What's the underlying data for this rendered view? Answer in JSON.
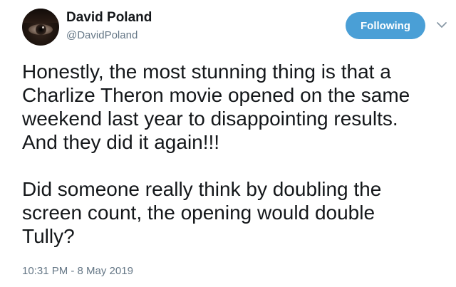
{
  "author": {
    "display_name": "David Poland",
    "handle": "@DavidPoland",
    "avatar_icon": "eye-avatar"
  },
  "actions": {
    "follow_label": "Following",
    "follow_color": "#4a9fd6",
    "menu_icon": "chevron-down-icon"
  },
  "tweet": {
    "text_1": "Honestly, the most stunning thing is that a\nCharlize Theron movie opened on the same\nweekend last year to disappointing results.\nAnd they did it again!!!",
    "text_2": "Did someone really think by doubling the\nscreen count, the opening would double\nTully?",
    "timestamp": "10:31 PM - 8 May 2019"
  }
}
